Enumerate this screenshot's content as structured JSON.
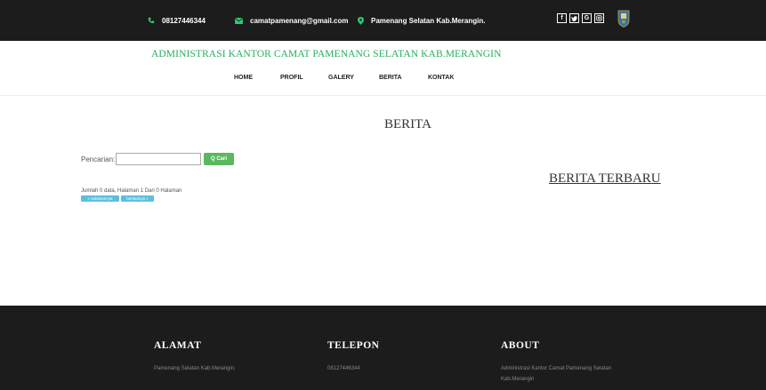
{
  "topbar": {
    "phone": "08127446344",
    "email": "camatpamenang@gmail.com",
    "address": "Pamenang Selatan Kab.Merangin.",
    "social": [
      {
        "icon": "facebook-icon",
        "glyph": "f"
      },
      {
        "icon": "twitter-icon",
        "glyph": "•"
      },
      {
        "icon": "google-icon",
        "glyph": "G"
      },
      {
        "icon": "instagram-icon",
        "glyph": "◎"
      }
    ]
  },
  "header": {
    "site_title": "ADMINISTRASI KANTOR CAMAT PAMENANG SELATAN KAB.MERANGIN"
  },
  "nav": [
    "HOME",
    "PROFIL",
    "GALERY",
    "BERITA",
    "KONTAK"
  ],
  "main": {
    "page_title": "BERITA",
    "search_label": "Pencarian:",
    "search_value": "",
    "search_button": "Q Cari",
    "count_text": "Jumlah 0 data, Halaman 1 Dari 0 Halaman",
    "prev_label": "« sebelumnya",
    "next_label": "berikutnya »"
  },
  "sidebar": {
    "title": "BERITA TERBARU"
  },
  "footer": {
    "alamat_title": "ALAMAT",
    "alamat_text": "Pamenang Selatan Kab.Merangin.",
    "telepon_title": "TELEPON",
    "telepon_text": "08127446344",
    "about_title": "ABOUT",
    "about_text_line1": "Administrasi Kantor Camat Pamenang Selatan",
    "about_text_line2": "Kab.Merangin"
  },
  "colors": {
    "topbar_bg": "#1c1c1c",
    "accent_green": "#27ae60",
    "button_green": "#5cb85c",
    "pager_blue": "#5bc0de"
  }
}
